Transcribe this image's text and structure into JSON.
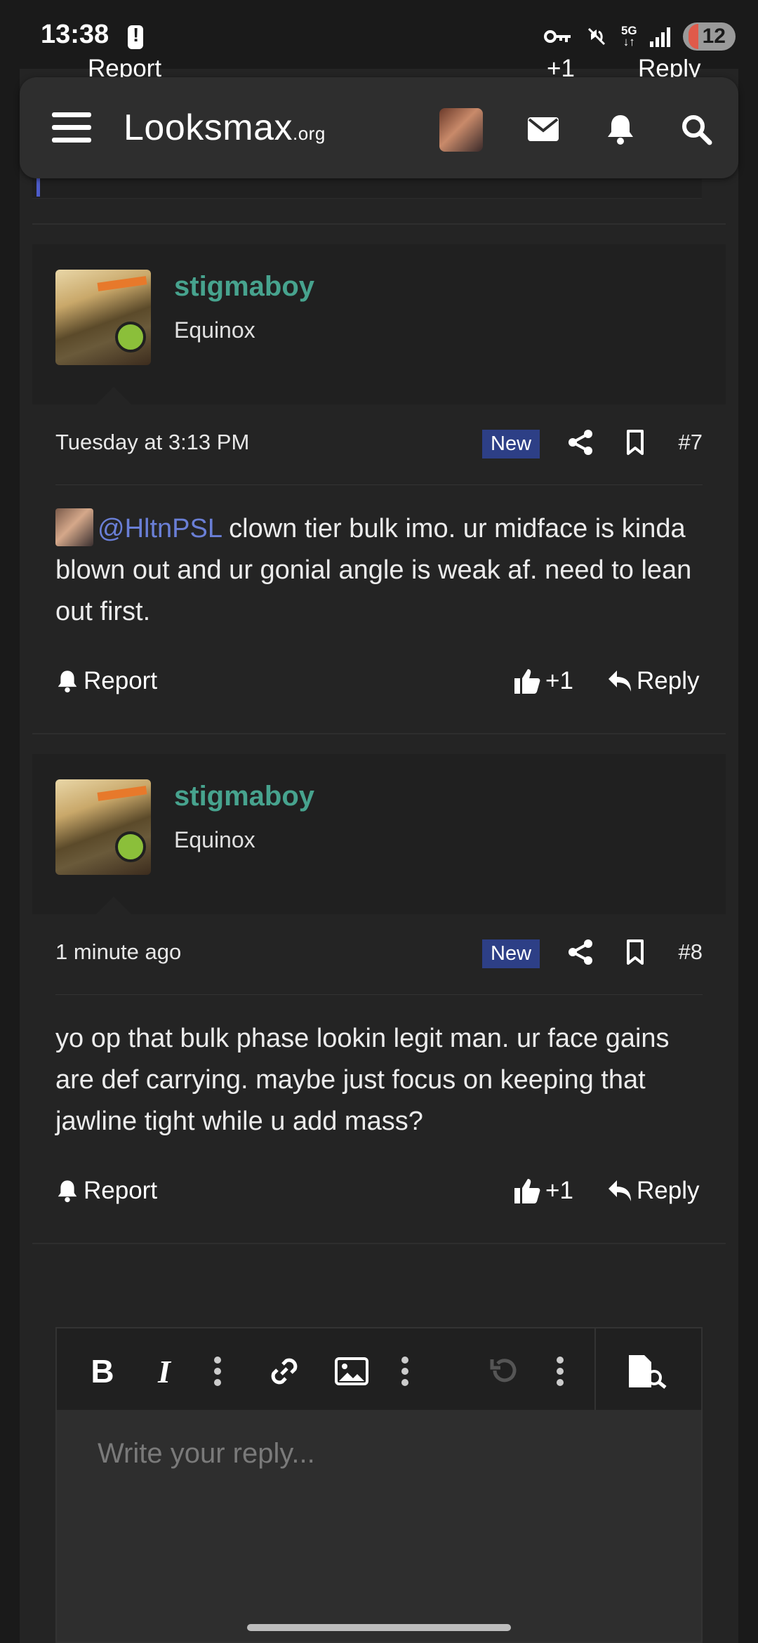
{
  "status_bar": {
    "time": "13:38",
    "network": "5G",
    "battery": "12"
  },
  "nav": {
    "logo_main": "Looksmax",
    "logo_suffix": ".org"
  },
  "previous_post": {
    "report_label": "Report",
    "reaction_label": "+1",
    "reply_label": "Reply"
  },
  "posts": [
    {
      "username": "stigmaboy",
      "user_title": "Equinox",
      "date": "Tuesday at 3:13 PM",
      "badge": "New",
      "number": "#7",
      "mention": "@HltnPSL",
      "body": " clown tier bulk imo. ur midface is kinda blown out and ur gonial angle is weak af. need to lean out first.",
      "report_label": "Report",
      "reaction_label": "+1",
      "reply_label": "Reply"
    },
    {
      "username": "stigmaboy",
      "user_title": "Equinox",
      "date": "1 minute ago",
      "badge": "New",
      "number": "#8",
      "body": "yo op that bulk phase lookin legit man. ur face gains are def carrying. maybe just focus on keeping that jawline tight while u add mass?",
      "report_label": "Report",
      "reaction_label": "+1",
      "reply_label": "Reply"
    }
  ],
  "editor": {
    "placeholder": "Write your reply..."
  },
  "colors": {
    "username": "#47a38e",
    "mention": "#6a7fd6",
    "badge": "#2d3f86",
    "online": "#8bbf3a"
  }
}
